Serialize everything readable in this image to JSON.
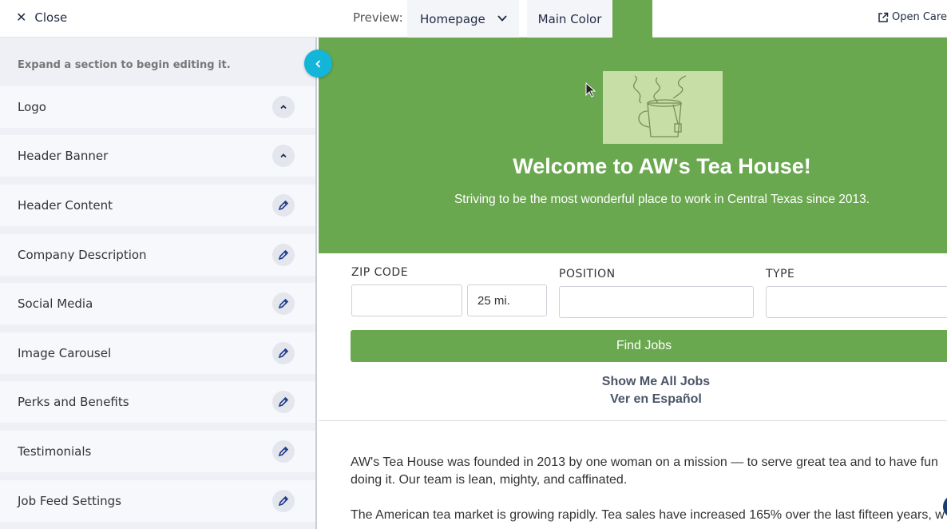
{
  "topbar": {
    "close_label": "Close",
    "preview_label": "Preview:",
    "page_select_value": "Homepage",
    "main_color_label": "Main Color",
    "main_color_value": "#6aa84f",
    "open_career_label": "Open Caree"
  },
  "sidebar": {
    "hint": "Expand a section to begin editing it.",
    "sections": [
      {
        "label": "Logo",
        "icon": "chevron-up-icon"
      },
      {
        "label": "Header Banner",
        "icon": "chevron-up-icon"
      },
      {
        "label": "Header Content",
        "icon": "pencil-icon"
      },
      {
        "label": "Company Description",
        "icon": "pencil-icon"
      },
      {
        "label": "Social Media",
        "icon": "pencil-icon"
      },
      {
        "label": "Image Carousel",
        "icon": "pencil-icon"
      },
      {
        "label": "Perks and Benefits",
        "icon": "pencil-icon"
      },
      {
        "label": "Testimonials",
        "icon": "pencil-icon"
      },
      {
        "label": "Job Feed Settings",
        "icon": "pencil-icon"
      }
    ]
  },
  "preview": {
    "hero": {
      "title": "Welcome to AW's Tea House!",
      "subtitle": "Striving to be the most wonderful place to work in Central Texas since 2013."
    },
    "search": {
      "zip_label": "ZIP CODE",
      "zip_value": "",
      "radius_value": "25 mi.",
      "position_label": "POSITION",
      "position_value": "",
      "type_label": "TYPE",
      "type_value": "",
      "find_button": "Find Jobs",
      "show_all_link": "Show Me All Jobs",
      "spanish_link": "Ver en Español"
    },
    "description": {
      "p1_line1": "AW's Tea House was founded in 2013 by one woman on a mission — to serve great tea and to have fun",
      "p1_line2": "doing it. Our team is lean, mighty, and caffinated.",
      "p2_line1": "The American tea market is growing rapidly. Tea sales have increased 165% over the last fifteen years, w"
    }
  },
  "colors": {
    "brand_green": "#6aa84f",
    "logo_bg": "#c7dea6",
    "toggle_cyan": "#13b5d8",
    "navy": "#1f2a44"
  }
}
